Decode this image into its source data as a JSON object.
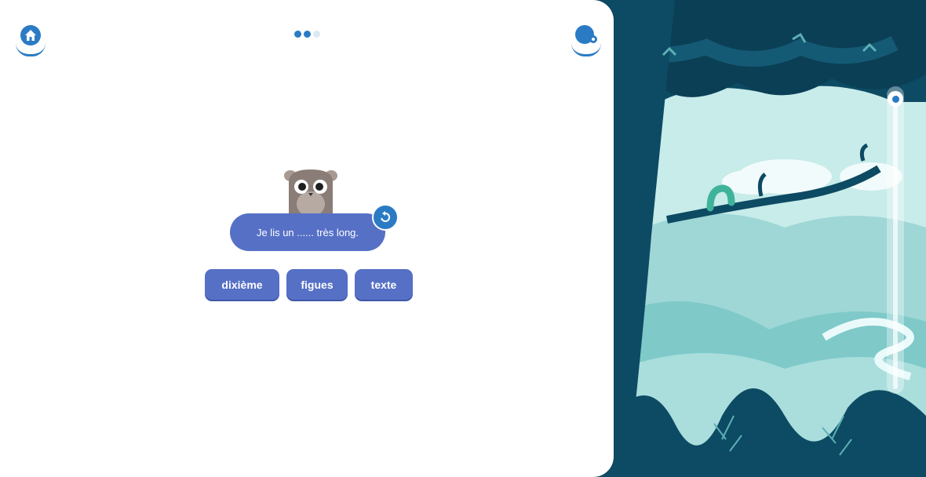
{
  "exercise": {
    "sentence": "Je lis un ...... très long.",
    "choices": [
      "dixième",
      "figues",
      "texte"
    ]
  },
  "progress": {
    "completed": 2,
    "total": 3
  },
  "reading_slider": {
    "level": 1.0
  },
  "icons": {
    "home": "home-icon",
    "profile": "profile-icon",
    "replay": "replay-icon"
  },
  "colors": {
    "accent": "#2b7bc4",
    "bubble": "#5670c6",
    "forest_dark": "#0d4a63",
    "forest_light": "#b7e3e3"
  }
}
